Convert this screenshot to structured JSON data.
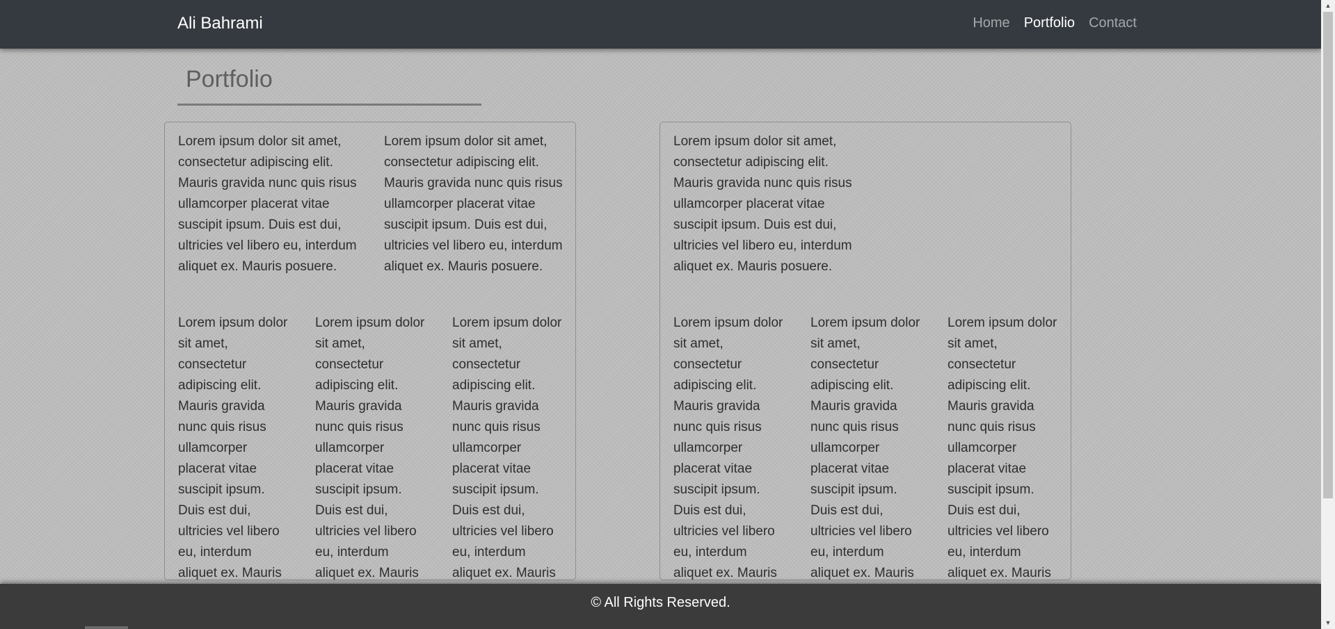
{
  "navbar": {
    "brand": "Ali Bahrami",
    "links": [
      "Home",
      "Portfolio",
      "Contact"
    ]
  },
  "page": {
    "title": "Portfolio"
  },
  "panels": [
    {
      "rows": [
        [
          "Lorem ipsum dolor sit amet, consectetur adipiscing elit. Mauris gravida nunc quis risus ullamcorper placerat vitae suscipit ipsum. Duis est dui, ultricies vel libero eu, interdum aliquet ex. Mauris posuere.",
          "Lorem ipsum dolor sit amet, consectetur adipiscing elit. Mauris gravida nunc quis risus ullamcorper placerat vitae suscipit ipsum. Duis est dui, ultricies vel libero eu, interdum aliquet ex. Mauris posuere."
        ],
        [
          "Lorem ipsum dolor sit amet, consectetur adipiscing elit. Mauris gravida nunc quis risus ullamcorper placerat vitae suscipit ipsum. Duis est dui, ultricies vel libero eu, interdum aliquet ex. Mauris posuere.",
          "Lorem ipsum dolor sit amet, consectetur adipiscing elit. Mauris gravida nunc quis risus ullamcorper placerat vitae suscipit ipsum. Duis est dui, ultricies vel libero eu, interdum aliquet ex. Mauris posuere.",
          "Lorem ipsum dolor sit amet, consectetur adipiscing elit. Mauris gravida nunc quis risus ullamcorper placerat vitae suscipit ipsum. Duis est dui, ultricies vel libero eu, interdum aliquet ex. Mauris posuere."
        ]
      ]
    },
    {
      "rows": [
        [
          "Lorem ipsum dolor sit amet, consectetur adipiscing elit. Mauris gravida nunc quis risus ullamcorper placerat vitae suscipit ipsum. Duis est dui, ultricies vel libero eu, interdum aliquet ex. Mauris posuere."
        ],
        [
          "Lorem ipsum dolor sit amet, consectetur adipiscing elit. Mauris gravida nunc quis risus ullamcorper placerat vitae suscipit ipsum. Duis est dui, ultricies vel libero eu, interdum aliquet ex. Mauris posuere.",
          "Lorem ipsum dolor sit amet, consectetur adipiscing elit. Mauris gravida nunc quis risus ullamcorper placerat vitae suscipit ipsum. Duis est dui, ultricies vel libero eu, interdum aliquet ex. Mauris posuere.",
          "Lorem ipsum dolor sit amet, consectetur adipiscing elit. Mauris gravida nunc quis risus ullamcorper placerat vitae suscipit ipsum. Duis est dui, ultricies vel libero eu, interdum aliquet ex. Mauris posuere."
        ]
      ]
    }
  ],
  "footer": {
    "text": "© All Rights Reserved."
  },
  "colors": {
    "navbar": "#353a40",
    "footer": "#3b3b3b",
    "active_link": "#ffffff",
    "inactive_link": "#a5a8ab"
  },
  "icons": {
    "scroll_up": "scroll-up-arrow-icon",
    "scroll_down": "scroll-down-arrow-icon"
  }
}
